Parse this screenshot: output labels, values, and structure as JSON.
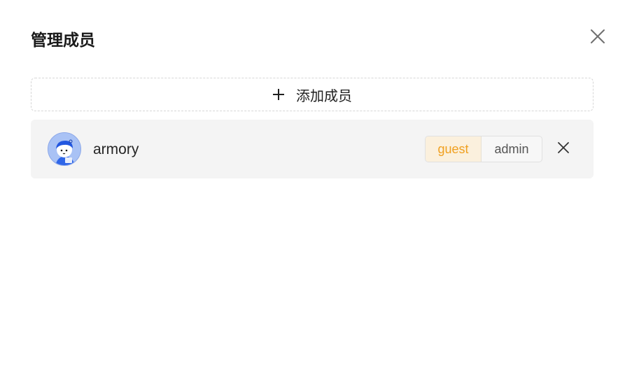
{
  "dialog": {
    "title": "管理成员",
    "close_icon": "close-icon",
    "add_button": {
      "icon": "plus-icon",
      "label": "添加成员"
    },
    "members": [
      {
        "name": "armory",
        "avatar_icon": "avatar-icon",
        "roles": [
          "guest",
          "admin"
        ],
        "selected_role": "guest",
        "remove_icon": "close-icon"
      }
    ]
  },
  "colors": {
    "accent": "#f0a020",
    "accent_bg": "#fbf0dd",
    "row_bg": "#f4f4f4"
  }
}
